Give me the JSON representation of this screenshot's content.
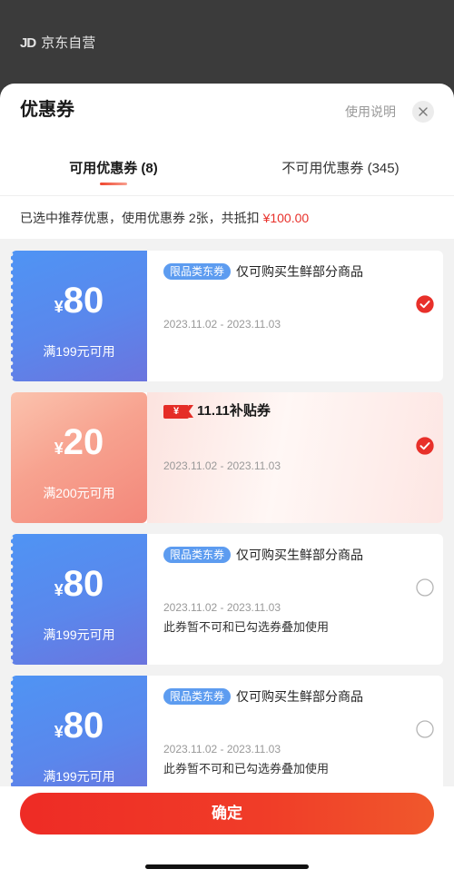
{
  "background_page": {
    "logo_text": "JD",
    "store_label": "京东自营"
  },
  "sheet": {
    "title": "优惠券",
    "help_link": "使用说明",
    "close_icon": "close-icon"
  },
  "tabs": [
    {
      "label": "可用优惠券 (8)",
      "active": true
    },
    {
      "label": "不可用优惠券 (345)",
      "active": false
    }
  ],
  "summary": {
    "text": "已选中推荐优惠，使用优惠券 2张，共抵扣 ",
    "amount": "¥100.00"
  },
  "coupons": [
    {
      "type": "limited-category",
      "currency": "¥",
      "amount": "80",
      "condition": "满199元可用",
      "badge": "限品类东券",
      "description": "仅可购买生鲜部分商品",
      "validity": "2023.11.02 - 2023.11.03",
      "selected": true
    },
    {
      "type": "promo",
      "currency": "¥",
      "amount": "20",
      "condition": "满200元可用",
      "promo_flag_symbol": "¥",
      "promo_title": "11.11补贴券",
      "validity": "2023.11.02 - 2023.11.03",
      "selected": true
    },
    {
      "type": "limited-category",
      "currency": "¥",
      "amount": "80",
      "condition": "满199元可用",
      "badge": "限品类东券",
      "description": "仅可购买生鲜部分商品",
      "validity": "2023.11.02 - 2023.11.03",
      "note": "此券暂不可和已勾选券叠加使用",
      "selected": false
    },
    {
      "type": "limited-category",
      "currency": "¥",
      "amount": "80",
      "condition": "满199元可用",
      "badge": "限品类东券",
      "description": "仅可购买生鲜部分商品",
      "validity": "2023.11.02 - 2023.11.03",
      "note": "此券暂不可和已勾选券叠加使用",
      "selected": false
    }
  ],
  "footer": {
    "confirm_label": "确定"
  },
  "colors": {
    "accent": "#e8302a",
    "badge": "#5d9cf0",
    "coupon_blue": "#5a87ec",
    "promo_pink": "#f7a28f"
  }
}
